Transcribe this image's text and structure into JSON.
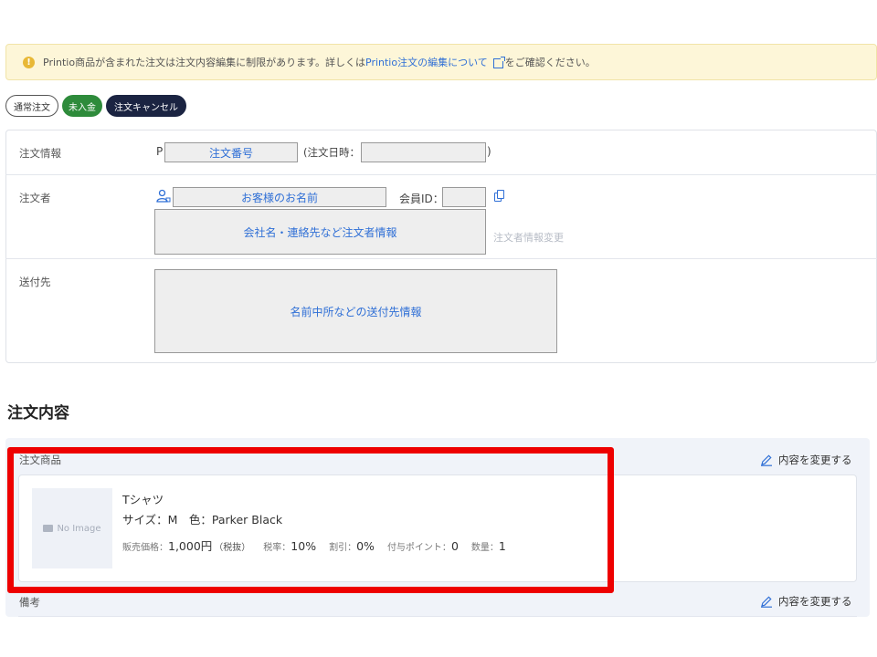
{
  "notice": {
    "text_before": "Printio商品が含まれた注文は注文内容編集に制限があります。詳しくは",
    "link_text": "Printio注文の編集について",
    "text_after": "をご確認ください。"
  },
  "badges": {
    "type": "通常注文",
    "payment": "未入金",
    "cancel": "注文キャンセル"
  },
  "order_info": {
    "label": "注文情報",
    "prefix": "P",
    "order_number": "注文番号",
    "date_label": "(注文日時：",
    "date_close": ")"
  },
  "orderer": {
    "label": "注文者",
    "name": "お客様のお名前",
    "member_id_label": "会員ID：",
    "details": "会社名・連絡先など注文者情報",
    "change_link": "注文者情報変更"
  },
  "shipping": {
    "label": "送付先",
    "details": "名前中所などの送付先情報"
  },
  "contents": {
    "title": "注文内容",
    "products_label": "注文商品",
    "edit_label": "内容を変更する",
    "notes_label": "備考",
    "notes_edit_label": "内容を変更する"
  },
  "product": {
    "image_placeholder": "No Image",
    "name": "Tシャツ",
    "variant": "サイズ：M　色：Parker Black",
    "price_label": "販売価格：",
    "price_value": "1,000円",
    "price_note": "（税抜）",
    "tax_label": "税率：",
    "tax_value": "10%",
    "discount_label": "割引：",
    "discount_value": "0%",
    "points_label": "付与ポイント：",
    "points_value": "0",
    "qty_label": "数量：",
    "qty_value": "1"
  },
  "colors": {
    "accent_blue": "#2f6fd6",
    "unpaid_green": "#2e8b3b",
    "cancel_navy": "#1b2442",
    "highlight_red": "#ee0000",
    "notice_bg": "#fdf6d8"
  }
}
